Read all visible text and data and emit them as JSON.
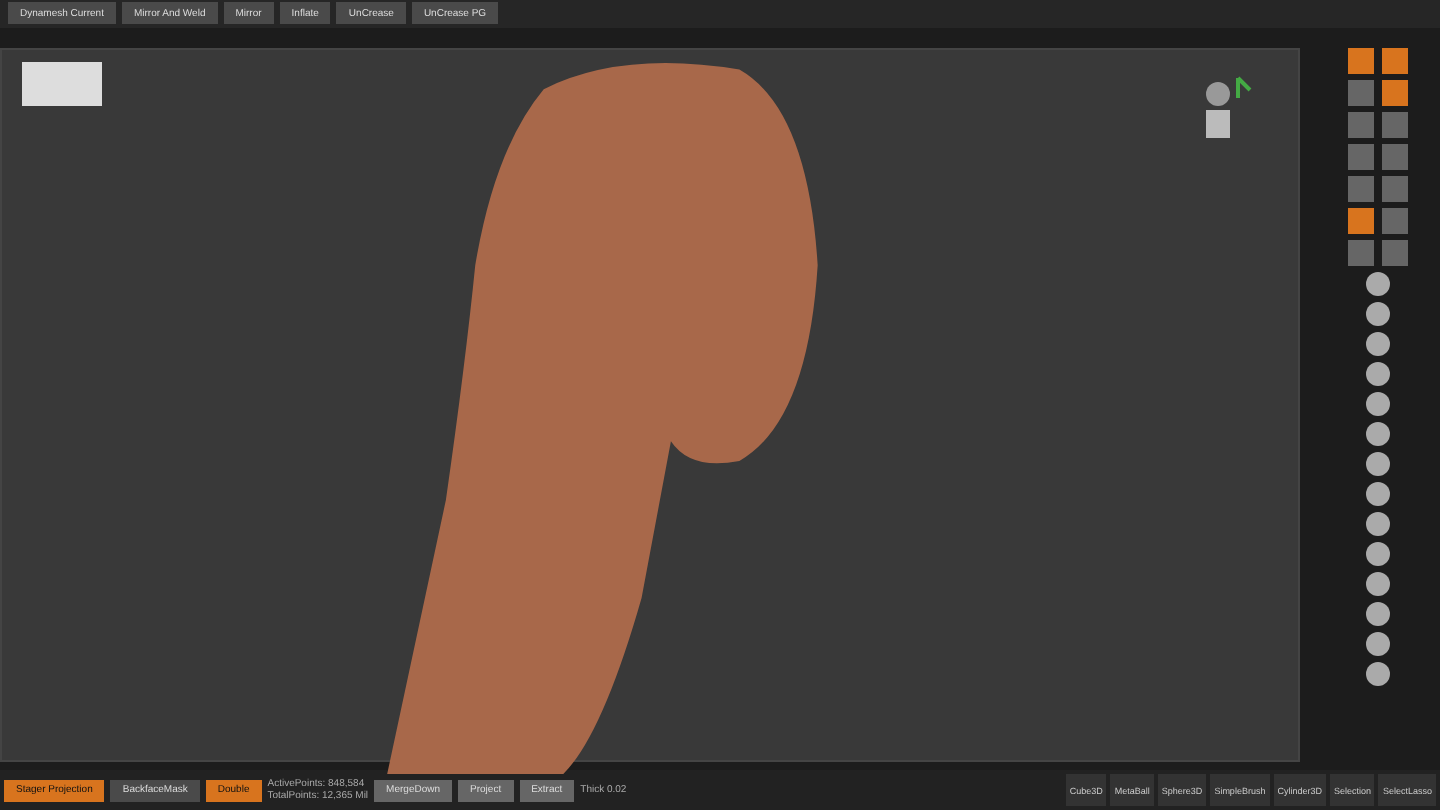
{
  "top_bar": {
    "buttons": [
      {
        "label": "Dynamesh Current",
        "on": false
      },
      {
        "label": "Mirror And Weld",
        "on": false
      },
      {
        "label": "Mirror",
        "on": false
      },
      {
        "label": "Inflate",
        "on": false
      },
      {
        "label": "UnCrease",
        "on": false
      },
      {
        "label": "UnCrease PG",
        "on": false
      }
    ]
  },
  "bottom_bar": {
    "buttons": [
      {
        "label": "Stager Projection",
        "on": true
      },
      {
        "label": "BackfaceMask",
        "on": false
      },
      {
        "label": "Double",
        "on": true
      }
    ],
    "stats": [
      "ActivePoints: 848,584",
      "TotalPoints: 12,365 Mil"
    ],
    "actions": [
      "MergeDown",
      "Project",
      "Extract"
    ],
    "thick": "Thick 0.02",
    "tools": [
      "Cube3D",
      "MetaBall",
      "Sphere3D",
      "SimpleBrush",
      "Cylinder3D",
      "Selection",
      "SelectLasso"
    ]
  }
}
